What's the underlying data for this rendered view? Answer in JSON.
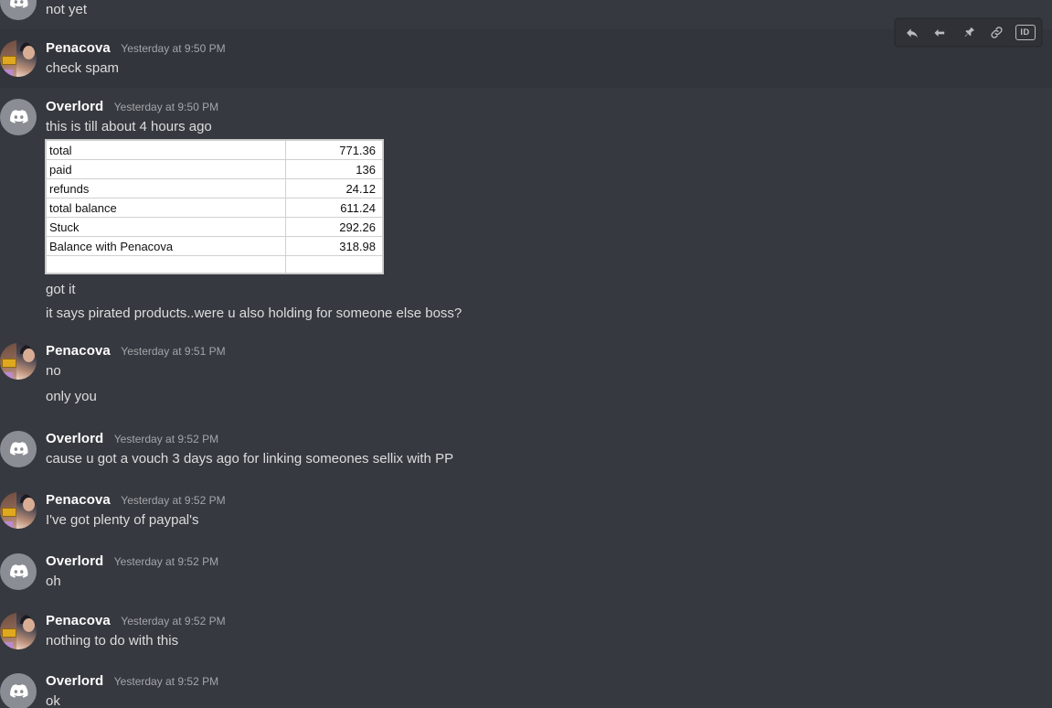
{
  "app": "discord-chat",
  "theme": {
    "background": "#36393f",
    "background_hover": "#32353b",
    "text": "#dcddde",
    "username": "#ffffff",
    "timestamp": "#a3a6aa",
    "toolbar_background": "#2f3136",
    "toolbar_icon": "#b9bbbe"
  },
  "hover_toolbar": {
    "buttons": [
      {
        "name": "reply-icon",
        "label": "Reply"
      },
      {
        "name": "mark-unread-icon",
        "label": "Mark Unread"
      },
      {
        "name": "pin-icon",
        "label": "Pin Message"
      },
      {
        "name": "copy-link-icon",
        "label": "Copy Message Link"
      },
      {
        "name": "copy-id-icon",
        "label": "ID"
      }
    ]
  },
  "messages": [
    {
      "id": "m0",
      "author": "Overlord",
      "avatar": "discord",
      "timestamp": "",
      "continuation": true,
      "hovered": false,
      "partial_avatar": true,
      "lines": [
        "not yet"
      ]
    },
    {
      "id": "m1",
      "author": "Penacova",
      "avatar": "photo",
      "timestamp": "Yesterday at 9:50 PM",
      "continuation": false,
      "hovered": true,
      "lines": [
        "check spam"
      ]
    },
    {
      "id": "m2",
      "author": "Overlord",
      "avatar": "discord",
      "timestamp": "Yesterday at 9:50 PM",
      "continuation": false,
      "hovered": false,
      "lines": [
        "this is till about 4 hours ago"
      ],
      "attachment": "balance-table",
      "lines_after": [
        "got it",
        "it says pirated products..were u also holding for someone else boss?"
      ]
    },
    {
      "id": "m3",
      "author": "Penacova",
      "avatar": "photo",
      "timestamp": "Yesterday at 9:51 PM",
      "continuation": false,
      "hovered": false,
      "lines": [
        "no",
        "only you"
      ]
    },
    {
      "id": "m4",
      "author": "Overlord",
      "avatar": "discord",
      "timestamp": "Yesterday at 9:52 PM",
      "continuation": false,
      "hovered": false,
      "lines": [
        "cause u got a vouch 3 days ago for linking someones sellix with PP"
      ]
    },
    {
      "id": "m5",
      "author": "Penacova",
      "avatar": "photo",
      "timestamp": "Yesterday at 9:52 PM",
      "continuation": false,
      "hovered": false,
      "lines": [
        "I've got plenty of paypal's"
      ]
    },
    {
      "id": "m6",
      "author": "Overlord",
      "avatar": "discord",
      "timestamp": "Yesterday at 9:52 PM",
      "continuation": false,
      "hovered": false,
      "lines": [
        "oh"
      ]
    },
    {
      "id": "m7",
      "author": "Penacova",
      "avatar": "photo",
      "timestamp": "Yesterday at 9:52 PM",
      "continuation": false,
      "hovered": false,
      "lines": [
        "nothing to do with this"
      ]
    },
    {
      "id": "m8",
      "author": "Overlord",
      "avatar": "discord",
      "timestamp": "Yesterday at 9:52 PM",
      "continuation": false,
      "hovered": false,
      "lines": [
        "ok"
      ]
    }
  ],
  "balance_table": {
    "rows": [
      {
        "label": "total",
        "value": "771.36"
      },
      {
        "label": "paid",
        "value": "136"
      },
      {
        "label": "refunds",
        "value": "24.12"
      },
      {
        "label": "total balance",
        "value": "611.24"
      },
      {
        "label": "Stuck",
        "value": "292.26"
      },
      {
        "label": "Balance with Penacova",
        "value": "318.98"
      },
      {
        "label": "",
        "value": ""
      }
    ]
  }
}
